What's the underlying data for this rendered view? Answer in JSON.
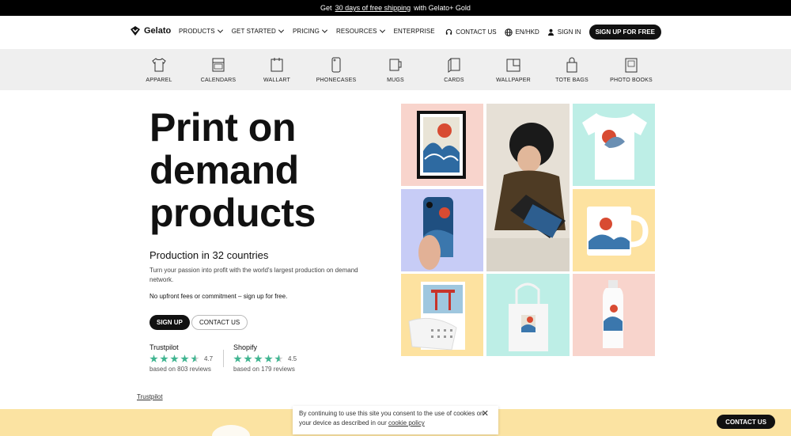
{
  "promo": {
    "prefix": "Get",
    "link": "30 days of free shipping",
    "suffix": "with Gelato+ Gold"
  },
  "header": {
    "logo": "Gelato",
    "nav": [
      {
        "label": "PRODUCTS",
        "has_dropdown": true
      },
      {
        "label": "GET STARTED",
        "has_dropdown": true
      },
      {
        "label": "PRICING",
        "has_dropdown": true
      },
      {
        "label": "RESOURCES",
        "has_dropdown": true
      },
      {
        "label": "ENTERPRISE",
        "has_dropdown": false
      }
    ],
    "contact": "CONTACT US",
    "locale": "EN/HKD",
    "signin": "SIGN IN",
    "signup": "SIGN UP FOR FREE"
  },
  "categories": [
    {
      "label": "APPAREL",
      "icon": "tshirt-icon"
    },
    {
      "label": "CALENDARS",
      "icon": "calendar-icon"
    },
    {
      "label": "WALLART",
      "icon": "wallart-icon"
    },
    {
      "label": "PHONECASES",
      "icon": "phone-icon"
    },
    {
      "label": "MUGS",
      "icon": "mug-icon"
    },
    {
      "label": "CARDS",
      "icon": "card-icon"
    },
    {
      "label": "WALLPAPER",
      "icon": "wallpaper-icon"
    },
    {
      "label": "TOTE BAGS",
      "icon": "tote-bag-icon"
    },
    {
      "label": "PHOTO BOOKS",
      "icon": "photo-book-icon"
    }
  ],
  "hero": {
    "title_lines": [
      "Print on",
      "demand",
      "products"
    ],
    "subtitle": "Production in 32 countries",
    "description": "Turn your passion into profit with the world's largest production on demand network.",
    "nofees": "No upfront fees or commitment – sign up for free.",
    "signup": "SIGN UP",
    "contact": "CONTACT US"
  },
  "ratings": [
    {
      "name": "Trustpilot",
      "score": "4.7",
      "based": "based on 803 reviews",
      "stars": 4.7
    },
    {
      "name": "Shopify",
      "score": "4.5",
      "based": "based on 179 reviews",
      "stars": 4.5
    }
  ],
  "trustpilot_link": "Trustpilot",
  "cookie": {
    "text": "By continuing to use this site you consent to the use of cookies on your device as described in our",
    "link": "cookie policy"
  },
  "contact_float": "CONTACT US",
  "colors": {
    "pink": "#f8d4cc",
    "mint": "#bdeee6",
    "lavender": "#c7ccf6",
    "butter": "#fde2a0",
    "black": "#111111",
    "star": "#3fb490"
  }
}
